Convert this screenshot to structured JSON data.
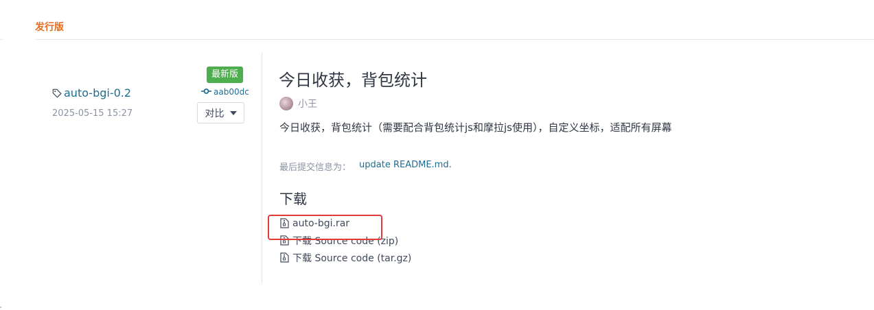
{
  "section": {
    "title": "发行版"
  },
  "release": {
    "latest_badge": "最新版",
    "tag": "auto-bgi-0.2",
    "date": "2025-05-15 15:27",
    "commit": "aab00dc",
    "compare_label": "对比",
    "title": "今日收获，背包统计",
    "author": "小王",
    "description": "今日收获，背包统计（需要配合背包统计js和摩拉js使用），自定义坐标，适配所有屏幕",
    "last_commit_label": "最后提交信息为：",
    "last_commit_message": "update README.md."
  },
  "downloads": {
    "heading": "下载",
    "items": [
      {
        "label": "auto-bgi.rar",
        "icon": "file-archive-icon"
      },
      {
        "label": "下载 Source code (zip)",
        "icon": "file-archive-icon"
      },
      {
        "label": "下载 Source code (tar.gz)",
        "icon": "file-archive-icon"
      }
    ]
  },
  "colors": {
    "accent": "#e56d1f",
    "link": "#1d6d92",
    "badge": "#4cae4c",
    "highlight": "#e53935"
  }
}
